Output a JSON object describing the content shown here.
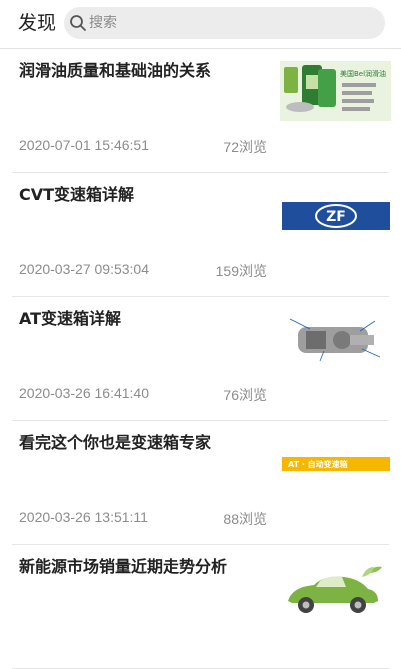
{
  "header": {
    "title": "发现",
    "search_placeholder": "搜索"
  },
  "articles": [
    {
      "title": "润滑油质量和基础油的关系",
      "date": "2020-07-01 15:46:51",
      "views": "72浏览",
      "thumb_text": "美国Bel润滑油",
      "thumb_icon": "oil-bottle-thumbnail"
    },
    {
      "title": "CVT变速箱详解",
      "date": "2020-03-27 09:53:04",
      "views": "159浏览",
      "thumb_text": "ZF",
      "thumb_icon": "zf-logo-thumbnail"
    },
    {
      "title": "AT变速箱详解",
      "date": "2020-03-26 16:41:40",
      "views": "76浏览",
      "thumb_text": "",
      "thumb_icon": "transmission-diagram-thumbnail"
    },
    {
      "title": "看完这个你也是变速箱专家",
      "date": "2020-03-26 13:51:11",
      "views": "88浏览",
      "thumb_text": "AT · 自动变速箱",
      "thumb_icon": "at-banner-thumbnail"
    },
    {
      "title": "新能源市场销量近期走势分析",
      "date": "",
      "views": "",
      "thumb_text": "",
      "thumb_icon": "green-car-thumbnail"
    }
  ],
  "colors": {
    "accent_green": "#8bc34a",
    "zf_blue": "#1f4e9c",
    "at_yellow": "#f5b700"
  }
}
